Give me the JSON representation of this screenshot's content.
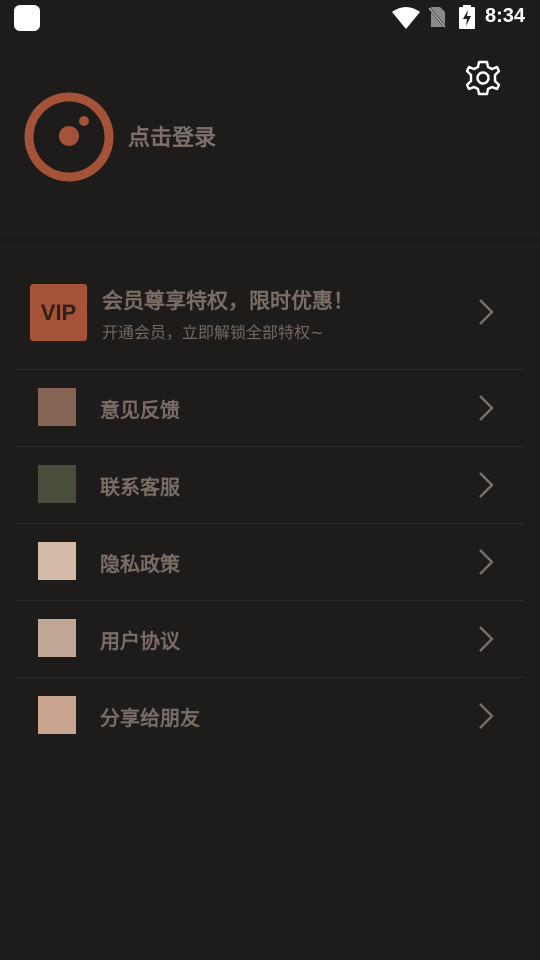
{
  "status_bar": {
    "time": "8:34",
    "icons": [
      "app-icon",
      "wifi-icon",
      "no-sim-icon",
      "battery-charging-icon"
    ]
  },
  "header": {
    "settings_icon": "gear-icon",
    "login_label": "点击登录",
    "brand_color": "#a55338"
  },
  "vip": {
    "badge": "VIP",
    "title": "会员尊享特权，限时优惠！",
    "subtitle": "开通会员，立即解锁全部特权~"
  },
  "menu": [
    {
      "label": "意见反馈",
      "icon_color": "#856456"
    },
    {
      "label": "联系客服",
      "icon_color": "#494d3b"
    },
    {
      "label": "隐私政策",
      "icon_color": "#d3baa7"
    },
    {
      "label": "用户协议",
      "icon_color": "#c1a796"
    },
    {
      "label": "分享给朋友",
      "icon_color": "#c9a591"
    }
  ]
}
